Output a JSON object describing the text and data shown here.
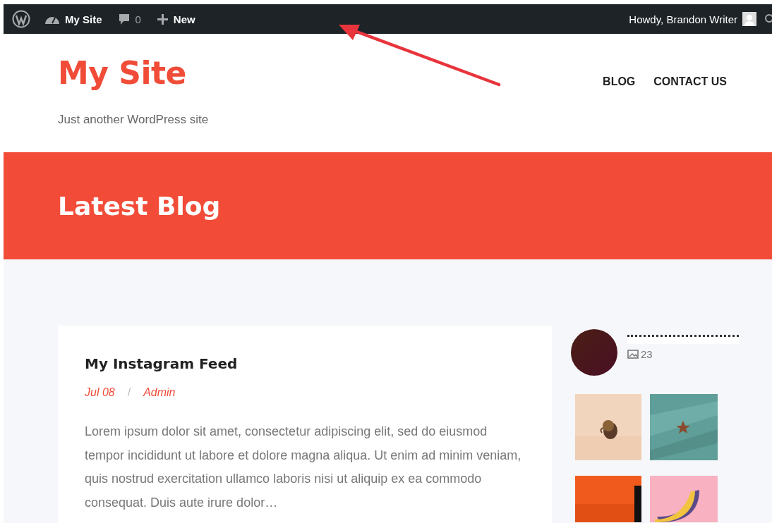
{
  "admin_bar": {
    "site_name": "My Site",
    "comments_count": "0",
    "new_label": "New",
    "greeting": "Howdy, Brandon Writer"
  },
  "site": {
    "title": "My Site",
    "tagline": "Just another WordPress site"
  },
  "nav": {
    "items": [
      {
        "label": "BLOG"
      },
      {
        "label": "CONTACT US"
      }
    ]
  },
  "banner": {
    "title": "Latest Blog"
  },
  "post": {
    "title": "My Instagram Feed",
    "date": "Jul 08",
    "separator": "/",
    "author": "Admin",
    "excerpt": "Lorem ipsum dolor sit amet, consectetur adipiscing elit, sed do eiusmod tempor incididunt ut labore et dolore magna aliqua. Ut enim ad minim veniam, quis nostrud exercitation ullamco laboris nisi ut aliquip ex ea commodo consequat. Duis aute irure dolor…"
  },
  "instagram": {
    "media_count": "23"
  }
}
